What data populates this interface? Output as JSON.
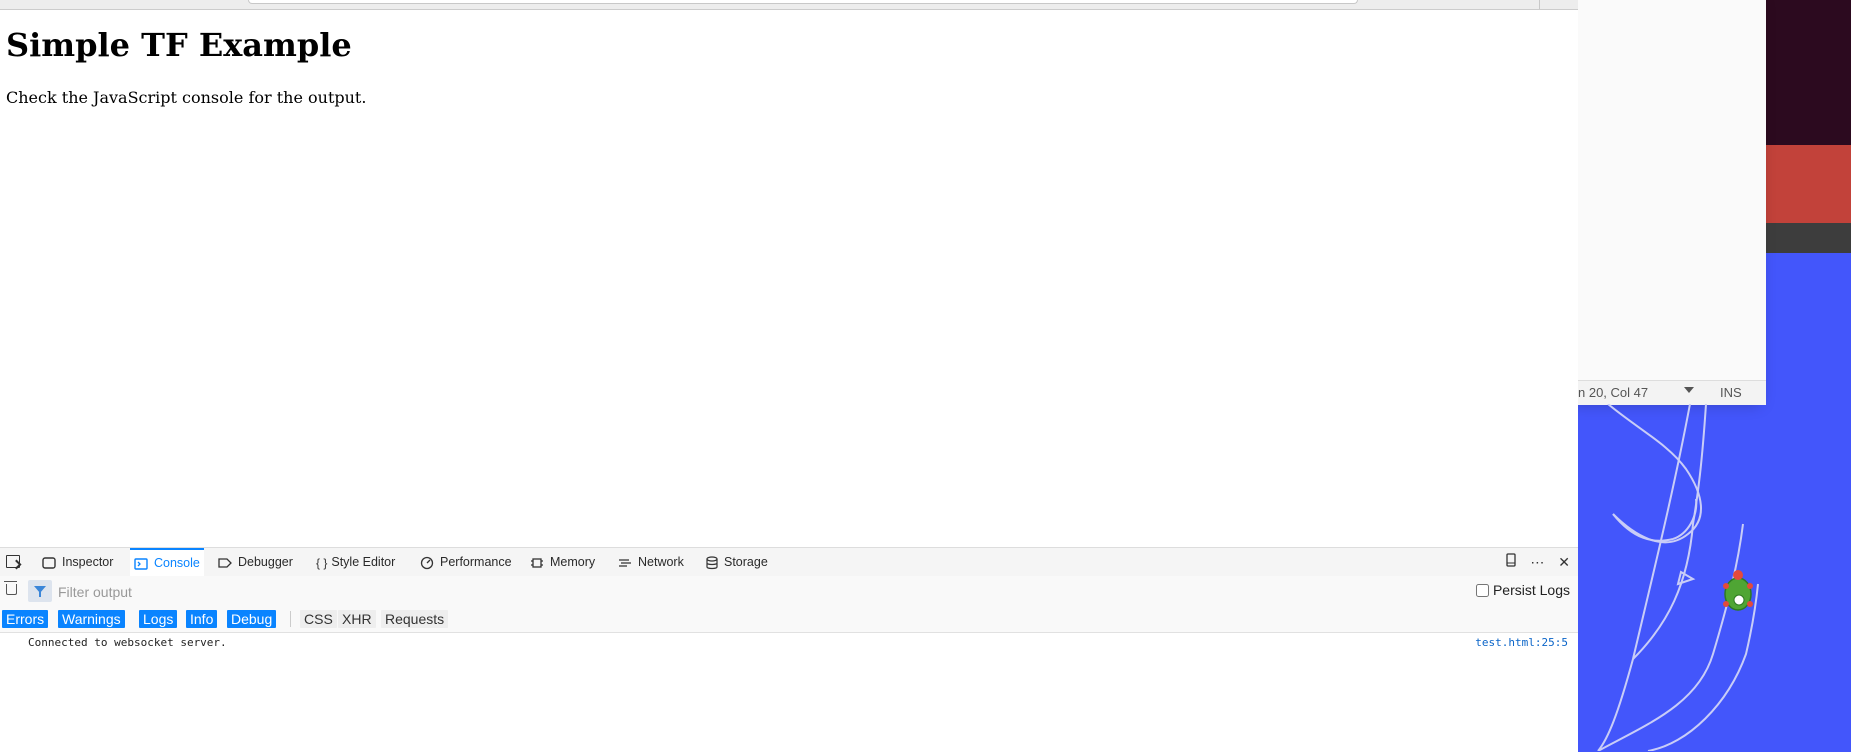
{
  "page": {
    "title": "Simple TF Example",
    "text": "Check the JavaScript console for the output."
  },
  "devtools": {
    "tabs": [
      {
        "label": "Inspector",
        "icon": "inspector-icon"
      },
      {
        "label": "Console",
        "icon": "console-icon",
        "active": true
      },
      {
        "label": "Debugger",
        "icon": "debugger-icon"
      },
      {
        "label": "Style Editor",
        "icon": "style-editor-icon"
      },
      {
        "label": "Performance",
        "icon": "performance-icon"
      },
      {
        "label": "Memory",
        "icon": "memory-icon"
      },
      {
        "label": "Network",
        "icon": "network-icon"
      },
      {
        "label": "Storage",
        "icon": "storage-icon"
      }
    ],
    "icon_glyphs": {
      "style_editor": "{ }",
      "more": "⋯",
      "close": "✕"
    },
    "filter": {
      "placeholder": "Filter output",
      "persist_label": "Persist Logs"
    },
    "levels": [
      "Errors",
      "Warnings",
      "Logs",
      "Info",
      "Debug"
    ],
    "categories": [
      "CSS",
      "XHR",
      "Requests"
    ],
    "messages": [
      {
        "text": "Connected to websocket server.",
        "location": "test.html:25:5"
      }
    ],
    "accent_color": "#0a84ff"
  },
  "editor_status": {
    "position": "n 20, Col 47",
    "mode": "INS"
  }
}
